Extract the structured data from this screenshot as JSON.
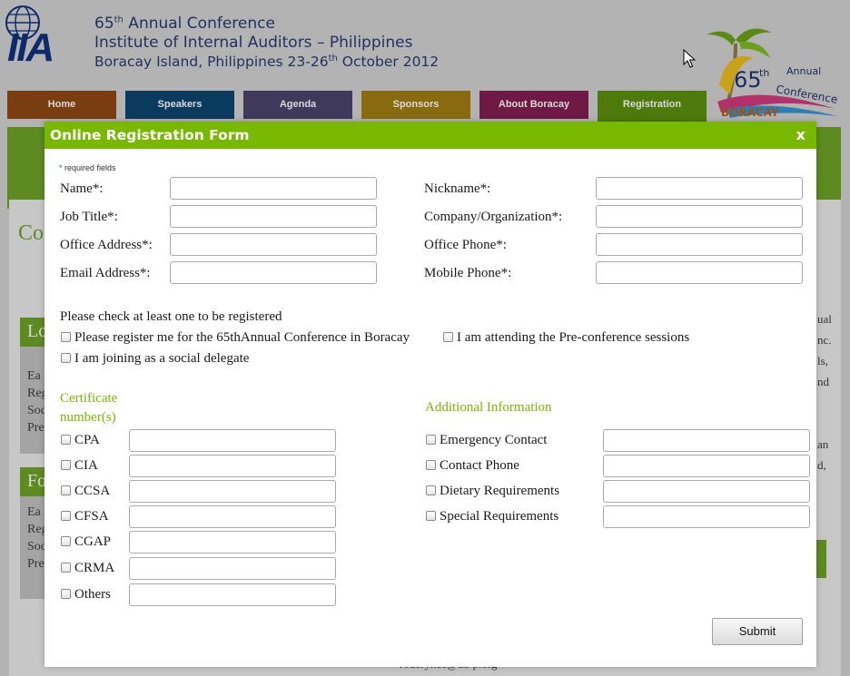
{
  "header": {
    "line1_prefix": "65",
    "line1_sup": "th",
    "line1_suffix": " Annual Conference",
    "line2": "Institute of Internal Auditors – Philippines",
    "line3_prefix": "Boracay Island, Philippines 23-26",
    "line3_sup": "th",
    "line3_suffix": " October 2012",
    "logo_text": "IIA",
    "boracay_logo": {
      "number": "65",
      "sup": "th",
      "line1": "Annual",
      "line2": "Conference",
      "place": "BORACAY"
    }
  },
  "nav": {
    "items": [
      {
        "label": "Home",
        "color": "#7a3d12"
      },
      {
        "label": "Speakers",
        "color": "#0b3a5f"
      },
      {
        "label": "Agenda",
        "color": "#3f3a5c"
      },
      {
        "label": "Sponsors",
        "color": "#8a6a0e"
      },
      {
        "label": "About Boracay",
        "color": "#6e1a44"
      },
      {
        "label": "Registration",
        "color": "#4d7a0b"
      }
    ]
  },
  "background": {
    "title_fragment": "Co",
    "box1_head": "Lo",
    "box1_lines": [
      "Ea",
      "Reg",
      "Soc",
      "Pre"
    ],
    "box2_head": "Fo",
    "box2_lines": [
      "Ea",
      "Reg",
      "Soc",
      "Pre"
    ],
    "right_fragments": [
      "ual",
      "nc.",
      "ls,",
      "nd",
      "",
      "",
      "an",
      "d,"
    ],
    "email_fragment": "roderyncc@ua-p.org"
  },
  "modal": {
    "title": "Online Registration Form",
    "close_label": "x",
    "required_star": "*",
    "required_note": " required fields",
    "fields_left": [
      {
        "label": "Name*:",
        "value": ""
      },
      {
        "label": "Job Title*:",
        "value": ""
      },
      {
        "label": "Office Address*:",
        "value": ""
      },
      {
        "label": "Email Address*:",
        "value": ""
      }
    ],
    "fields_right": [
      {
        "label": "Nickname*:",
        "value": ""
      },
      {
        "label": "Company/Organization*:",
        "value": ""
      },
      {
        "label": "Office Phone*:",
        "value": ""
      },
      {
        "label": "Mobile Phone*:",
        "value": ""
      }
    ],
    "register_prompt": "Please check at least one to be registered",
    "register_options": [
      "Please register me for the 65thAnnual Conference in Boracay",
      "I am attending the Pre-conference sessions",
      "I am joining as a social delegate"
    ],
    "certificate_heading_line1": "Certificate",
    "certificate_heading_line2": "number(s)",
    "certificates": [
      "CPA",
      "CIA",
      "CCSA",
      "CFSA",
      "CGAP",
      "CRMA",
      "Others"
    ],
    "additional_heading": "Additional Information",
    "additional": [
      "Emergency Contact",
      "Contact Phone",
      "Dietary Requirements",
      "Special Requirements"
    ],
    "submit_label": "Submit"
  },
  "colors": {
    "accent_green": "#79b800",
    "dim_green": "#5e8a22",
    "overlay_bg": "#b3b3b3"
  }
}
